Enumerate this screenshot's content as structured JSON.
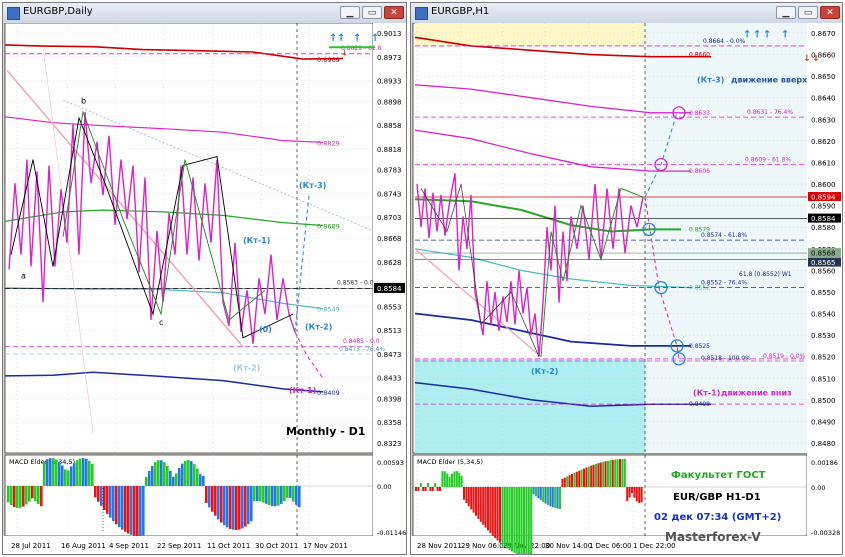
{
  "windows": {
    "left": {
      "title": "EURGBP,Daily"
    },
    "right": {
      "title": "EURGBP,H1"
    }
  },
  "chart_data": [
    {
      "type": "line",
      "symbol": "EURGBP",
      "timeframe": "Daily",
      "ylim": [
        0.8323,
        0.9013
      ],
      "y_ticks": [
        "0.9013",
        "0.8973",
        "0.8933",
        "0.8898",
        "0.8858",
        "0.8818",
        "0.8783",
        "0.8743",
        "0.8703",
        "0.8668",
        "0.8628",
        "0.8588",
        "0.8553",
        "0.8513",
        "0.8473",
        "0.8433",
        "0.8398",
        "0.8358",
        "0.8323"
      ],
      "x_ticks": [
        "28 Jul 2011",
        "16 Aug 2011",
        "4 Sep 2011",
        "22 Sep 2011",
        "11 Oct 2011",
        "30 Oct 2011",
        "17 Nov 2011"
      ],
      "current_price_label": "0.8584",
      "level_labels": [
        "0.8969",
        "0.8829",
        "0.8689",
        "0.8549",
        "0.8409"
      ],
      "dashed_level_labels": [
        "0.8829 - 61.8",
        "0.8583 - 0.0",
        "0.8485 - 0.0",
        "0.8473 - 76.4%"
      ],
      "wave_labels": [
        "a",
        "b",
        "c",
        "(0)",
        "(Кт-1)",
        "(Кт-2)",
        "(Кт-3)",
        "(Кт-2)",
        "(Кт-1)"
      ],
      "annotation": "Monthly - D1",
      "macd": {
        "title": "MACD Elder (5,34,5)",
        "y_ticks": [
          "0.00593",
          "0.00",
          "-0.01146"
        ]
      }
    },
    {
      "type": "line",
      "symbol": "EURGBP",
      "timeframe": "H1",
      "ylim": [
        0.848,
        0.867
      ],
      "y_ticks": [
        "0.8670",
        "0.8660",
        "0.8650",
        "0.8640",
        "0.8630",
        "0.8620",
        "0.8610",
        "0.8600",
        "0.8590",
        "0.8580",
        "0.8570",
        "0.8560",
        "0.8550",
        "0.8540",
        "0.8530",
        "0.8520",
        "0.8510",
        "0.8500",
        "0.8490",
        "0.8480"
      ],
      "price_labels": [
        "0.8594",
        "0.8584",
        "0.8568",
        "0.8565"
      ],
      "x_ticks": [
        "28 Nov 2011",
        "29 Nov 06:00",
        "29 Nov 22:00",
        "30 Nov 14:00",
        "1 Dec 06:00",
        "1 Dec 22:00"
      ],
      "level_labels": [
        "0.8660",
        "0.8633",
        "0.8606",
        "0.8579",
        "0.8552",
        "0.8525",
        "0.8498"
      ],
      "dashed_level_labels": [
        "0.8664 - 0.0%",
        "0.8631 - 76.4%",
        "0.8609 - 61.8%",
        "0.8574 - 61.8%",
        "61.8 (0.8552) W1",
        "0.8552 - 76.4%",
        "0.8518 - 100.0%",
        "0.8519 - 0.0%"
      ],
      "wave_labels": [
        "(Кт-3)",
        "(Кт-2)",
        "(Кт-1)"
      ],
      "annotations": [
        "движение вверх",
        "движение вниз",
        "Факультет ГОСТ",
        "EUR/GBP H1-D1",
        "02 дек 07:34  (GMT+2)",
        "Masterforex-V"
      ],
      "macd": {
        "title": "MACD Elder (5,34,5)",
        "y_ticks": [
          "0.00186",
          "0.00",
          "-0.00328"
        ]
      }
    }
  ],
  "colors": {
    "chart_bg": "#ffffff",
    "grid": "#c8c8c8",
    "price": "#000000",
    "price_alt": "#1a8a1a",
    "ma_red": "#cc0000",
    "ma_magenta": "#dd22cc",
    "ma_green": "#22aa22",
    "ma_cyan": "#44bbcc",
    "ma_blue": "#1a2aa0",
    "wave_blue": "#2288dd",
    "wave_magenta": "#dd22cc",
    "macd_green": "#22cc22",
    "macd_red": "#ee1111",
    "macd_blue": "#2277ee",
    "zone_cyan": "#aeeef0",
    "zone_yellow": "#fff7c8",
    "price_tag": "#000000"
  }
}
